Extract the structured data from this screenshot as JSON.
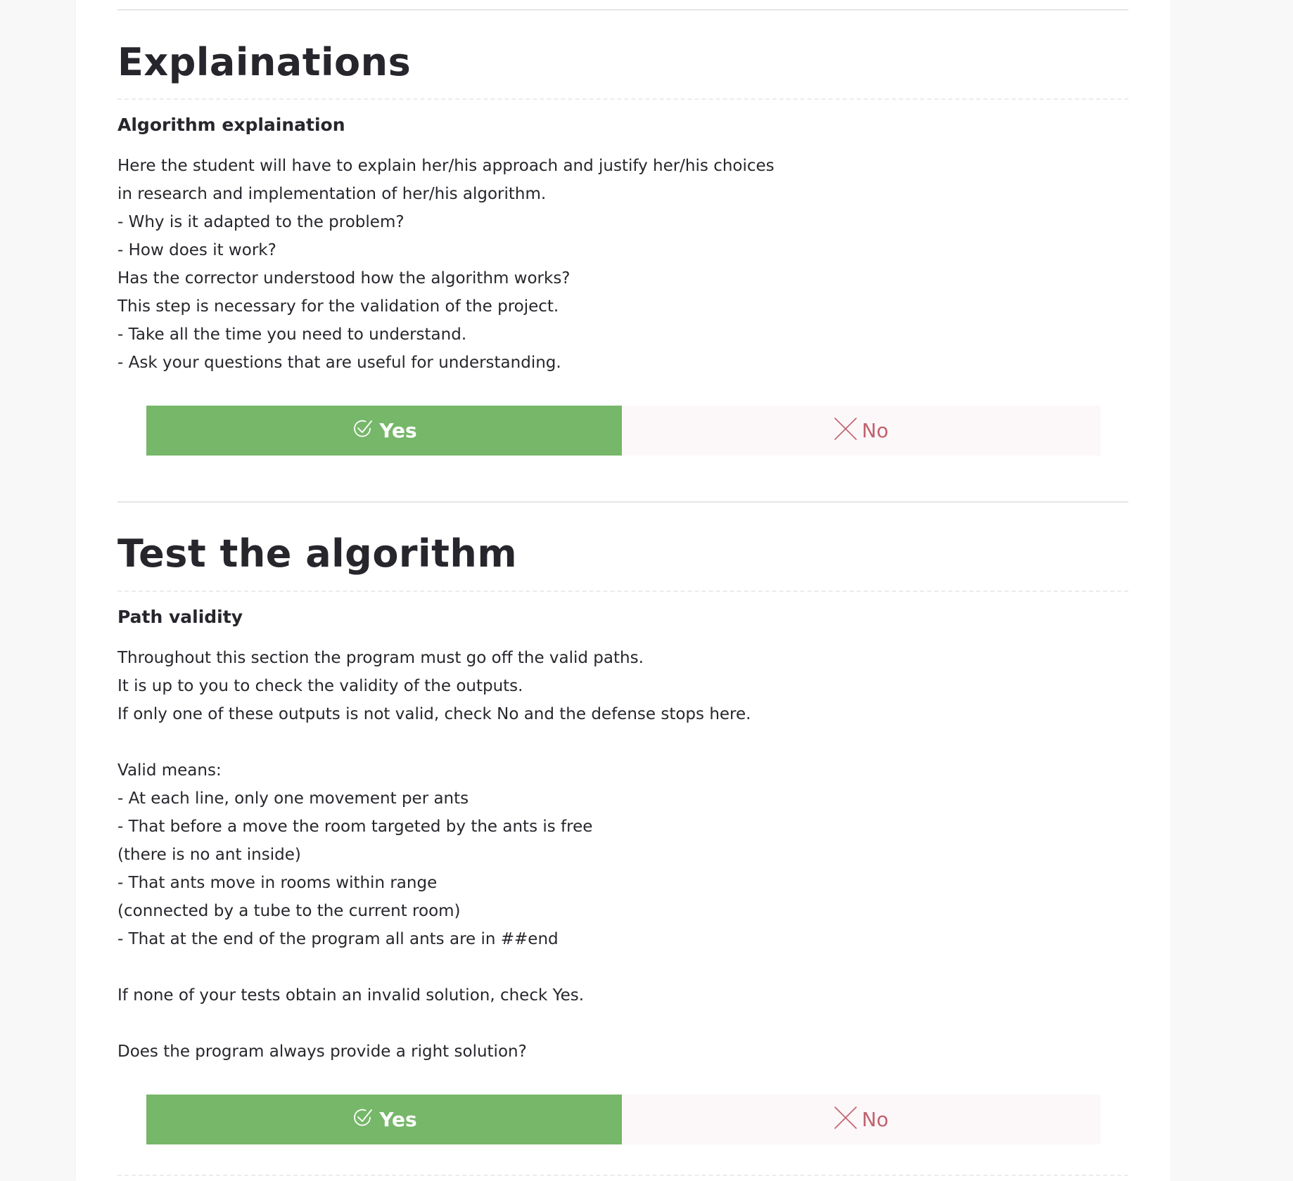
{
  "sections": [
    {
      "title": "Explainations",
      "question": {
        "title": "Algorithm explaination",
        "description_lines": [
          "Here the student will have to explain her/his approach and justify her/his choices",
          "in research and implementation of her/his algorithm.",
          "- Why is it adapted to the problem?",
          "- How does it work?",
          "Has the corrector understood how the algorithm works?",
          "This step is necessary for the validation of the project.",
          "- Take all the time you need to understand.",
          "- Ask your questions that are useful for understanding."
        ],
        "yes_label": "Yes",
        "no_label": "No"
      }
    },
    {
      "title": "Test the algorithm",
      "question": {
        "title": "Path validity",
        "description_lines": [
          "Throughout this section the program must go off the valid paths.",
          "It is up to you to check the validity of the outputs.",
          "If only one of these outputs is not valid, check No and the defense stops here.",
          "",
          "Valid means:",
          "- At each line, only one movement per ants",
          "- That before a move the room targeted by the ants is free",
          "(there is no ant inside)",
          "- That ants move in rooms within range",
          "(connected by a tube to the current room)",
          "- That at the end of the program all ants are in ##end",
          "",
          "If none of your tests obtain an invalid solution, check Yes.",
          "",
          "Does the program always provide a right solution?"
        ],
        "yes_label": "Yes",
        "no_label": "No"
      }
    }
  ],
  "icons": {
    "yes": "check-circle-icon",
    "no": "cross-icon"
  },
  "colors": {
    "yes_bg": "#76b769",
    "no_bg": "#fcf7f8",
    "no_text": "#c0626f",
    "text": "#26262c"
  }
}
